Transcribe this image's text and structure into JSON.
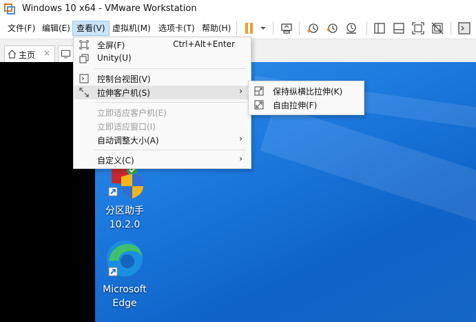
{
  "window": {
    "title": "Windows 10 x64 - VMware Workstation"
  },
  "menubar": {
    "items": [
      "文件(F)",
      "编辑(E)",
      "查看(V)",
      "虚拟机(M)",
      "选项卡(T)",
      "帮助(H)"
    ],
    "active_index": 2
  },
  "toolbar": {
    "icons": [
      "pause-icon",
      "dropdown-arrow-icon",
      "send-ctrl-alt-del-icon",
      "snapshot-icon",
      "revert-snapshot-icon",
      "snapshot-manager-icon",
      "library-icon",
      "thumbnail-icon",
      "fullscreen-icon",
      "unity-icon",
      "console-view-icon"
    ]
  },
  "tabs": {
    "home_label": "主页",
    "close": "×"
  },
  "view_menu": {
    "items": [
      {
        "label": "全屏(F)",
        "shortcut": "Ctrl+Alt+Enter",
        "icon": "fullscreen-icon"
      },
      {
        "label": "Unity(U)",
        "icon": "unity-icon"
      },
      {
        "label": "控制台视图(V)",
        "icon": "console-view-icon"
      },
      {
        "label": "拉伸客户机(S)",
        "icon": "stretch-icon",
        "has_submenu": true
      },
      {
        "label": "立即适应客户机(E)",
        "disabled": true
      },
      {
        "label": "立即适应窗口(I)",
        "disabled": true
      },
      {
        "label": "自动调整大小(A)",
        "has_submenu": true
      },
      {
        "label": "自定义(C)",
        "has_submenu": true
      }
    ],
    "arrow": "›"
  },
  "stretch_submenu": {
    "items": [
      {
        "label": "保持纵横比拉伸(K)",
        "icon": "keep-aspect-stretch-icon"
      },
      {
        "label": "自由拉伸(F)",
        "icon": "free-stretch-icon"
      }
    ]
  },
  "desktop": {
    "icons": [
      {
        "line1": "分区助手",
        "line2": "10.2.0"
      },
      {
        "line1": "Microsoft",
        "line2": "Edge"
      }
    ]
  },
  "colors": {
    "accent": "#cce4f7",
    "desktop_blue": "#1e7be0",
    "pause_orange": "#f29a2e"
  }
}
